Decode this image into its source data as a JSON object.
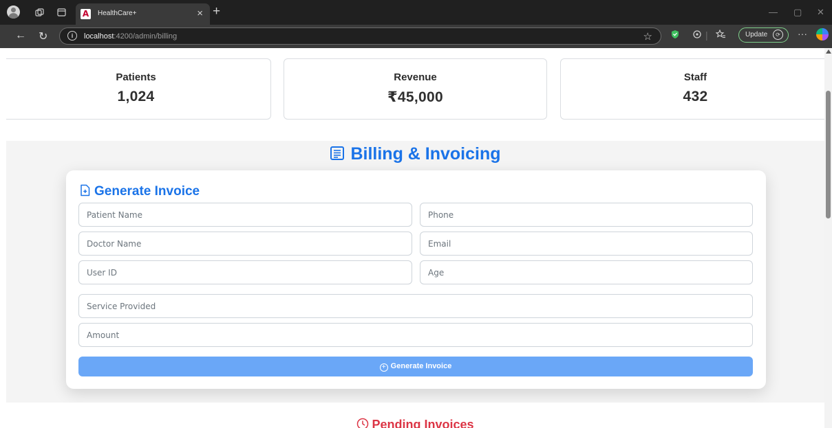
{
  "browser": {
    "tab_title": "HealthCare+",
    "tab_favicon": "A",
    "url_host": "localhost",
    "url_path": ":4200/admin/billing",
    "update_label": "Update"
  },
  "stats": [
    {
      "label": "Patients",
      "value": "1,024"
    },
    {
      "label": "Revenue",
      "value": "₹45,000"
    },
    {
      "label": "Staff",
      "value": "432"
    }
  ],
  "billing": {
    "title": "Billing & Invoicing",
    "card_title": "Generate Invoice",
    "fields": {
      "patient_name": "Patient Name",
      "phone": "Phone",
      "doctor_name": "Doctor Name",
      "email": "Email",
      "user_id": "User ID",
      "age": "Age",
      "service": "Service Provided",
      "amount": "Amount"
    },
    "submit_label": "Generate Invoice"
  },
  "pending": {
    "title": "Pending Invoices"
  },
  "colors": {
    "primary": "#1a73e8",
    "button": "#6aa7f7",
    "danger": "#dc3545",
    "chrome_dark": "#202020"
  }
}
